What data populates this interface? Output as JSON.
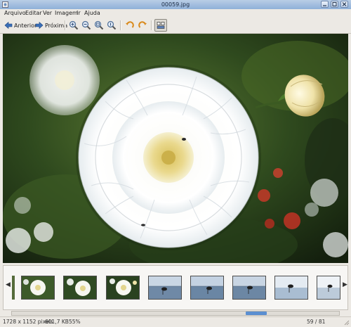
{
  "window": {
    "title": "00059.jpg"
  },
  "menu": {
    "items": [
      "Arquivo",
      "Editar",
      "Ver",
      "Imagem",
      "Ir",
      "Ajuda"
    ]
  },
  "toolbar": {
    "prev_label": "Anterior",
    "next_label": "Próxima",
    "icons": [
      "go-previous-icon",
      "go-next-icon",
      "zoom-in-icon",
      "zoom-out-icon",
      "zoom-fit-icon",
      "zoom-original-icon",
      "rotate-left-icon",
      "rotate-right-icon",
      "collection-icon"
    ]
  },
  "thumbnails": {
    "selected_index": 2,
    "items": [
      "flower-white",
      "flower-dahlia",
      "flower-dahlia-selected",
      "bird-lake",
      "bird-lake",
      "bird-lake",
      "bird-lake",
      "bird-lake"
    ]
  },
  "status": {
    "dimensions": "1728 x 1152 pixels",
    "filesize": "601,7 KB",
    "zoom": "55%",
    "position": "59 / 81"
  },
  "colors": {
    "selection": "#4a7fc0",
    "titlebar": "#a4bfe0"
  }
}
